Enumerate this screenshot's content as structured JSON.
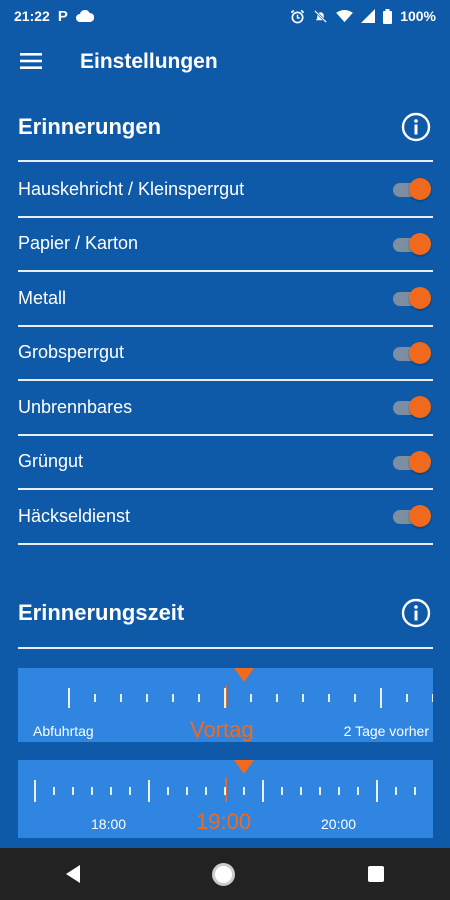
{
  "status_bar": {
    "time": "21:22",
    "carrier_icon": "P",
    "battery": "100%"
  },
  "app_bar": {
    "title": "Einstellungen"
  },
  "reminders": {
    "title": "Erinnerungen",
    "items": [
      {
        "label": "Hauskehricht / Kleinsperrgut",
        "enabled": true
      },
      {
        "label": "Papier / Karton",
        "enabled": true
      },
      {
        "label": "Metall",
        "enabled": true
      },
      {
        "label": "Grobsperrgut",
        "enabled": true
      },
      {
        "label": "Unbrennbares",
        "enabled": true
      },
      {
        "label": "Grüngut",
        "enabled": true
      },
      {
        "label": "Häckseldienst",
        "enabled": true
      }
    ]
  },
  "reminder_time": {
    "title": "Erinnerungszeit",
    "day_slider": {
      "left_label": "Abfuhrtag",
      "selected": "Vortag",
      "right_label": "2 Tage vorher"
    },
    "time_slider": {
      "left_label": "18:00",
      "selected": "19:00",
      "right_label": "20:00"
    }
  },
  "colors": {
    "background": "#0e5aa8",
    "accent": "#f06a1e",
    "slider_bg": "#2f85e0"
  }
}
